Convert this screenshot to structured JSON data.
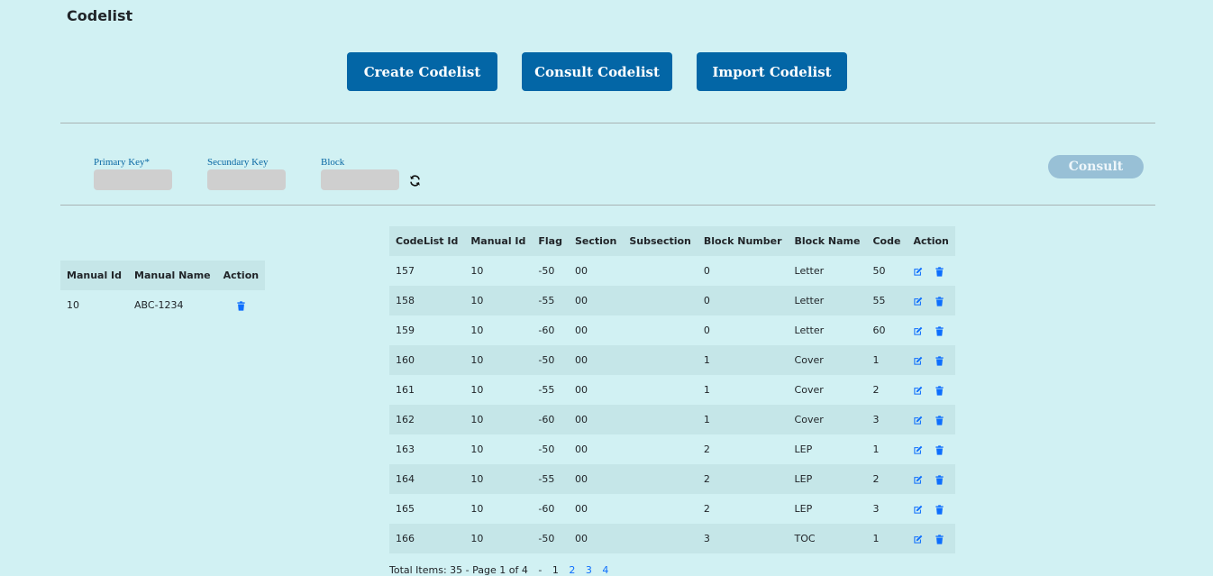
{
  "page_title": "Codelist",
  "top_buttons": {
    "create": "Create Codelist",
    "consult": "Consult Codelist",
    "import": "Import Codelist"
  },
  "filter": {
    "primary_key_label": "Primary Key*",
    "secundary_key_label": "Secundary Key",
    "block_label": "Block",
    "primary_key_value": "",
    "secundary_key_value": "",
    "block_value": "",
    "consult_label": "Consult"
  },
  "manual_table": {
    "headers": [
      "Manual Id",
      "Manual Name",
      "Action"
    ],
    "rows": [
      {
        "manual_id": "10",
        "manual_name": "ABC-1234"
      }
    ]
  },
  "codelist_table": {
    "headers": [
      "CodeList Id",
      "Manual Id",
      "Flag",
      "Section",
      "Subsection",
      "Block Number",
      "Block Name",
      "Code",
      "Action"
    ],
    "rows": [
      {
        "codelist_id": "157",
        "manual_id": "10",
        "flag": "-50",
        "section": "00",
        "subsection": "",
        "block_number": "0",
        "block_name": "Letter",
        "code": "50"
      },
      {
        "codelist_id": "158",
        "manual_id": "10",
        "flag": "-55",
        "section": "00",
        "subsection": "",
        "block_number": "0",
        "block_name": "Letter",
        "code": "55"
      },
      {
        "codelist_id": "159",
        "manual_id": "10",
        "flag": "-60",
        "section": "00",
        "subsection": "",
        "block_number": "0",
        "block_name": "Letter",
        "code": "60"
      },
      {
        "codelist_id": "160",
        "manual_id": "10",
        "flag": "-50",
        "section": "00",
        "subsection": "",
        "block_number": "1",
        "block_name": "Cover",
        "code": "1"
      },
      {
        "codelist_id": "161",
        "manual_id": "10",
        "flag": "-55",
        "section": "00",
        "subsection": "",
        "block_number": "1",
        "block_name": "Cover",
        "code": "2"
      },
      {
        "codelist_id": "162",
        "manual_id": "10",
        "flag": "-60",
        "section": "00",
        "subsection": "",
        "block_number": "1",
        "block_name": "Cover",
        "code": "3"
      },
      {
        "codelist_id": "163",
        "manual_id": "10",
        "flag": "-50",
        "section": "00",
        "subsection": "",
        "block_number": "2",
        "block_name": "LEP",
        "code": "1"
      },
      {
        "codelist_id": "164",
        "manual_id": "10",
        "flag": "-55",
        "section": "00",
        "subsection": "",
        "block_number": "2",
        "block_name": "LEP",
        "code": "2"
      },
      {
        "codelist_id": "165",
        "manual_id": "10",
        "flag": "-60",
        "section": "00",
        "subsection": "",
        "block_number": "2",
        "block_name": "LEP",
        "code": "3"
      },
      {
        "codelist_id": "166",
        "manual_id": "10",
        "flag": "-50",
        "section": "00",
        "subsection": "",
        "block_number": "3",
        "block_name": "TOC",
        "code": "1"
      }
    ]
  },
  "pagination": {
    "summary": "Total Items: 35 - Page 1 of 4",
    "separator": "-",
    "pages": [
      "1",
      "2",
      "3",
      "4"
    ],
    "current_page": "1"
  },
  "colors": {
    "background": "#d1f1f3",
    "primary_button": "#0366a6",
    "disabled_button": "#98c0d6",
    "action_icon": "#0d6efd",
    "row_stripe": "#c5e6e8"
  },
  "icons": {
    "refresh": "refresh-icon",
    "edit": "edit-icon",
    "delete": "trash-icon"
  }
}
